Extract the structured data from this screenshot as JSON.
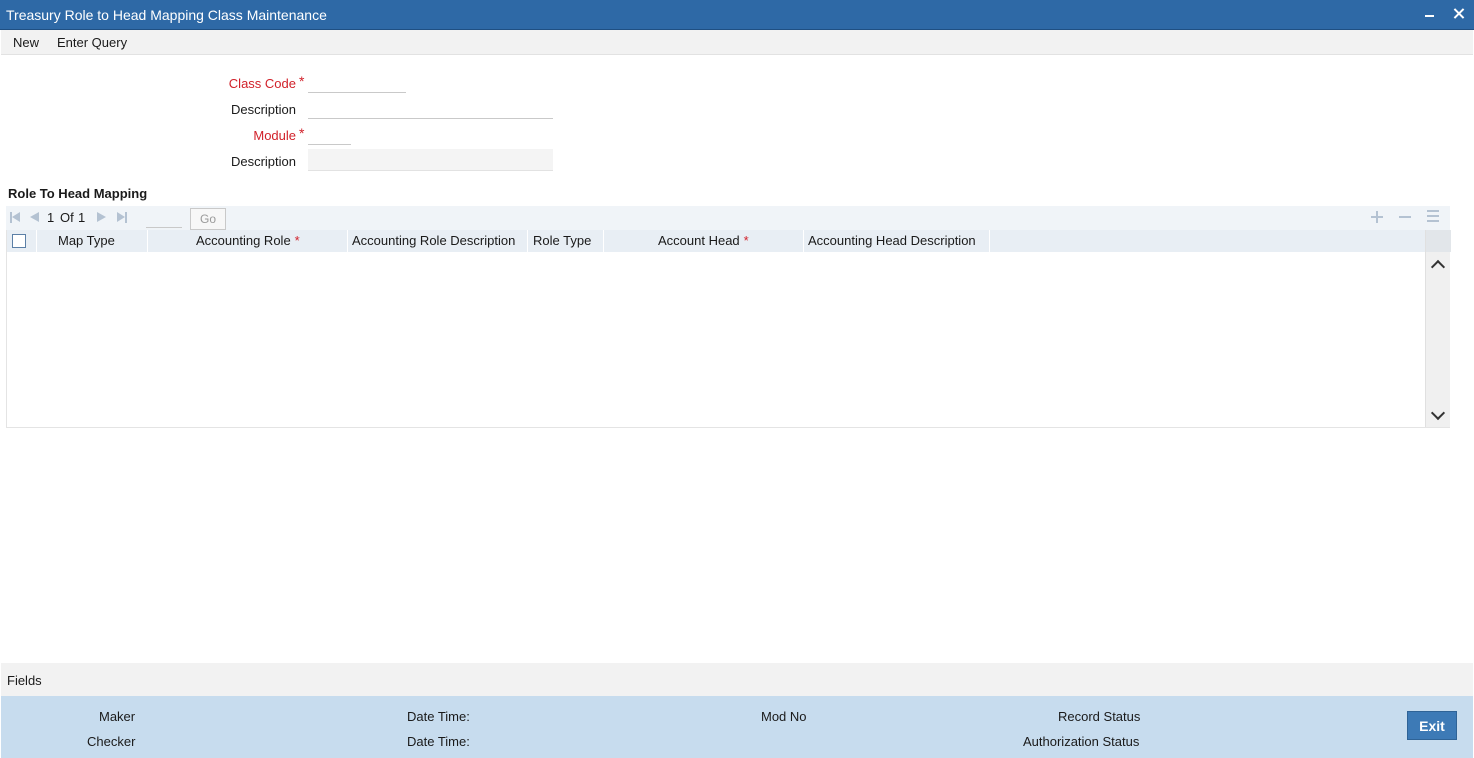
{
  "window": {
    "title": "Treasury Role to Head Mapping Class Maintenance"
  },
  "menu": {
    "items": [
      "New",
      "Enter Query"
    ]
  },
  "form": {
    "class_code": {
      "label": "Class Code",
      "value": "",
      "required": true
    },
    "class_description": {
      "label": "Description",
      "value": ""
    },
    "module": {
      "label": "Module",
      "value": "",
      "required": true
    },
    "module_description": {
      "label": "Description",
      "value": ""
    }
  },
  "section": {
    "title": "Role To Head Mapping"
  },
  "pagination": {
    "current": "1",
    "of_label": "Of",
    "total": "1",
    "go_label": "Go"
  },
  "grid": {
    "columns": [
      {
        "label": "Map Type",
        "required": false
      },
      {
        "label": "Accounting Role",
        "required": true
      },
      {
        "label": "Accounting Role Description",
        "required": false
      },
      {
        "label": "Role Type",
        "required": false
      },
      {
        "label": "Account Head",
        "required": true
      },
      {
        "label": "Accounting Head Description",
        "required": false
      }
    ],
    "required_marker": "*",
    "rows": []
  },
  "fields_bar": {
    "label": "Fields"
  },
  "footer": {
    "maker": "Maker",
    "checker": "Checker",
    "date_time_1": "Date Time:",
    "date_time_2": "Date Time:",
    "mod_no": "Mod No",
    "record_status": "Record Status",
    "authorization_status": "Authorization Status",
    "exit_label": "Exit"
  },
  "colors": {
    "titlebar": "#2e69a6",
    "required": "#d1212a",
    "footer": "#c7dcee",
    "exit_button": "#3d7ab6"
  }
}
